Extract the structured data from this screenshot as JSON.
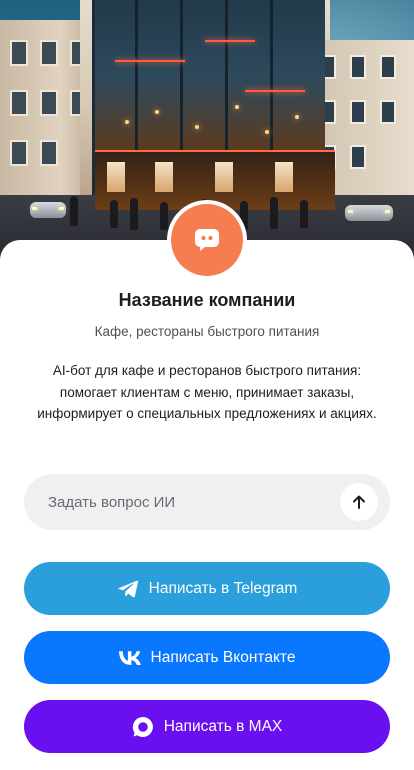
{
  "company": {
    "name": "Название компании",
    "category": "Кафе, рестораны быстрого питания",
    "description": "AI-бот для кафе и ресторанов быстрого питания: помогает клиентам с меню, принимает заказы, информирует о специальных предложениях и акциях."
  },
  "ask": {
    "placeholder": "Задать вопрос ИИ",
    "value": ""
  },
  "buttons": {
    "telegram": {
      "label": "Написать в Telegram",
      "color": "#2a9fdb",
      "icon": "telegram-icon"
    },
    "vk": {
      "label": "Написать Вконтакте",
      "color": "#0a77ff",
      "icon": "vk-icon"
    },
    "max": {
      "label": "Написать в MAX",
      "color": "#6a10f0",
      "icon": "max-icon"
    }
  },
  "colors": {
    "avatar": "#f57d4f",
    "input_background": "#f0f0f2"
  },
  "icons": {
    "avatar": "chat-bot-icon",
    "send": "arrow-up-icon"
  }
}
